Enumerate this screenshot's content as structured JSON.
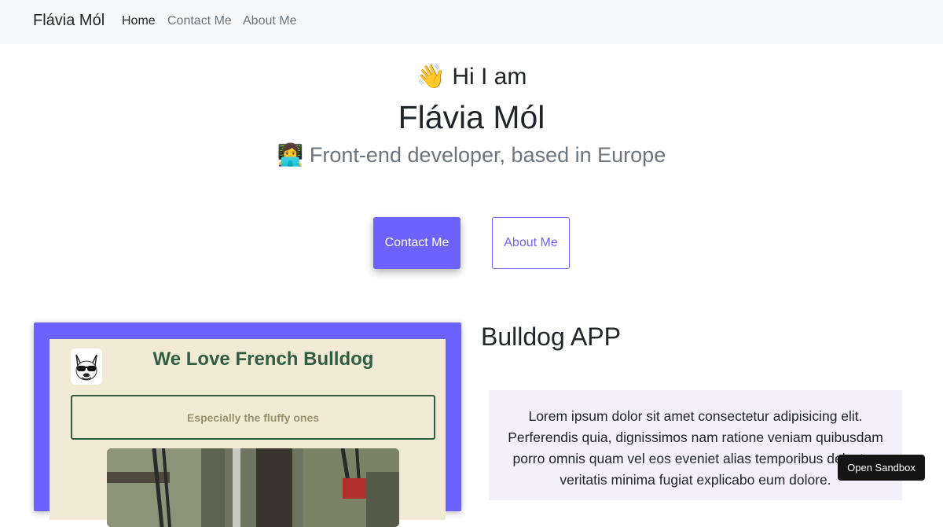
{
  "navbar": {
    "brand": "Flávia Mól",
    "links": [
      {
        "label": "Home",
        "active": true
      },
      {
        "label": "Contact Me",
        "active": false
      },
      {
        "label": "About Me",
        "active": false
      }
    ]
  },
  "hero": {
    "greeting": "👋 Hi I am",
    "name": "Flávia Mól",
    "subtitle": "👩‍💻 Front-end developer, based in Europe"
  },
  "buttons": {
    "contact_label": "Contact Me",
    "about_label": "About Me"
  },
  "project": {
    "preview": {
      "title": "We Love French Bulldog",
      "tagline": "Especially the fluffy ones",
      "logo_icon": "bulldog-sunglasses-icon",
      "photo": "park-swing-photo"
    },
    "title": "Bulldog APP",
    "description": "Lorem ipsum dolor sit amet consectetur adipisicing elit. Perferendis quia, dignissimos nam ratione veniam quibusdam porro omnis quam vel eos eveniet alias temporibus delectus veritatis minima fugiat explicabo eum dolore."
  },
  "sandbox": {
    "label": "Open Sandbox"
  },
  "colors": {
    "accent": "#6c63ff",
    "navbar_bg": "#f8f9fa",
    "preview_bg": "#f1ebd6",
    "preview_green": "#2f5e41",
    "desc_bg": "#f3effb"
  }
}
